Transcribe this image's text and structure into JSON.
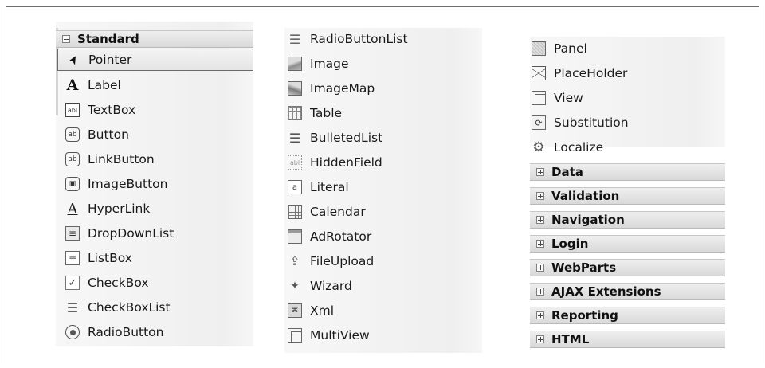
{
  "toolbox": {
    "standard_header": "Standard",
    "column1": [
      {
        "label": "Pointer",
        "icon": "pointer-icon",
        "glyph": "➤"
      },
      {
        "label": "Label",
        "icon": "label-icon",
        "glyph": "A"
      },
      {
        "label": "TextBox",
        "icon": "textbox-icon",
        "glyph": "abl"
      },
      {
        "label": "Button",
        "icon": "button-icon",
        "glyph": "ab"
      },
      {
        "label": "LinkButton",
        "icon": "linkbutton-icon",
        "glyph": "ab"
      },
      {
        "label": "ImageButton",
        "icon": "imagebutton-icon",
        "glyph": "▣"
      },
      {
        "label": "HyperLink",
        "icon": "hyperlink-icon",
        "glyph": "A"
      },
      {
        "label": "DropDownList",
        "icon": "dropdownlist-icon",
        "glyph": "≡"
      },
      {
        "label": "ListBox",
        "icon": "listbox-icon",
        "glyph": "≡"
      },
      {
        "label": "CheckBox",
        "icon": "checkbox-icon",
        "glyph": "✓"
      },
      {
        "label": "CheckBoxList",
        "icon": "checkboxlist-icon",
        "glyph": "☰"
      },
      {
        "label": "RadioButton",
        "icon": "radiobutton-icon",
        "glyph": ""
      }
    ],
    "column2": [
      {
        "label": "RadioButtonList",
        "icon": "radiobuttonlist-icon",
        "glyph": "☰"
      },
      {
        "label": "Image",
        "icon": "image-icon",
        "glyph": ""
      },
      {
        "label": "ImageMap",
        "icon": "imagemap-icon",
        "glyph": ""
      },
      {
        "label": "Table",
        "icon": "table-icon",
        "glyph": ""
      },
      {
        "label": "BulletedList",
        "icon": "bulletedlist-icon",
        "glyph": "☰"
      },
      {
        "label": "HiddenField",
        "icon": "hiddenfield-icon",
        "glyph": "abl"
      },
      {
        "label": "Literal",
        "icon": "literal-icon",
        "glyph": "a"
      },
      {
        "label": "Calendar",
        "icon": "calendar-icon",
        "glyph": ""
      },
      {
        "label": "AdRotator",
        "icon": "adrotator-icon",
        "glyph": ""
      },
      {
        "label": "FileUpload",
        "icon": "fileupload-icon",
        "glyph": "⇪"
      },
      {
        "label": "Wizard",
        "icon": "wizard-icon",
        "glyph": "✦"
      },
      {
        "label": "Xml",
        "icon": "xml-icon",
        "glyph": "⌘"
      },
      {
        "label": "MultiView",
        "icon": "multiview-icon",
        "glyph": ""
      }
    ],
    "column3": [
      {
        "label": "Panel",
        "icon": "panel-icon",
        "glyph": ""
      },
      {
        "label": "PlaceHolder",
        "icon": "placeholder-icon",
        "glyph": ""
      },
      {
        "label": "View",
        "icon": "view-icon",
        "glyph": ""
      },
      {
        "label": "Substitution",
        "icon": "substitution-icon",
        "glyph": "⟳"
      },
      {
        "label": "Localize",
        "icon": "localize-icon",
        "glyph": "⚙"
      }
    ],
    "collapsed_groups": [
      "Data",
      "Validation",
      "Navigation",
      "Login",
      "WebParts",
      "AJAX Extensions",
      "Reporting",
      "HTML"
    ]
  }
}
